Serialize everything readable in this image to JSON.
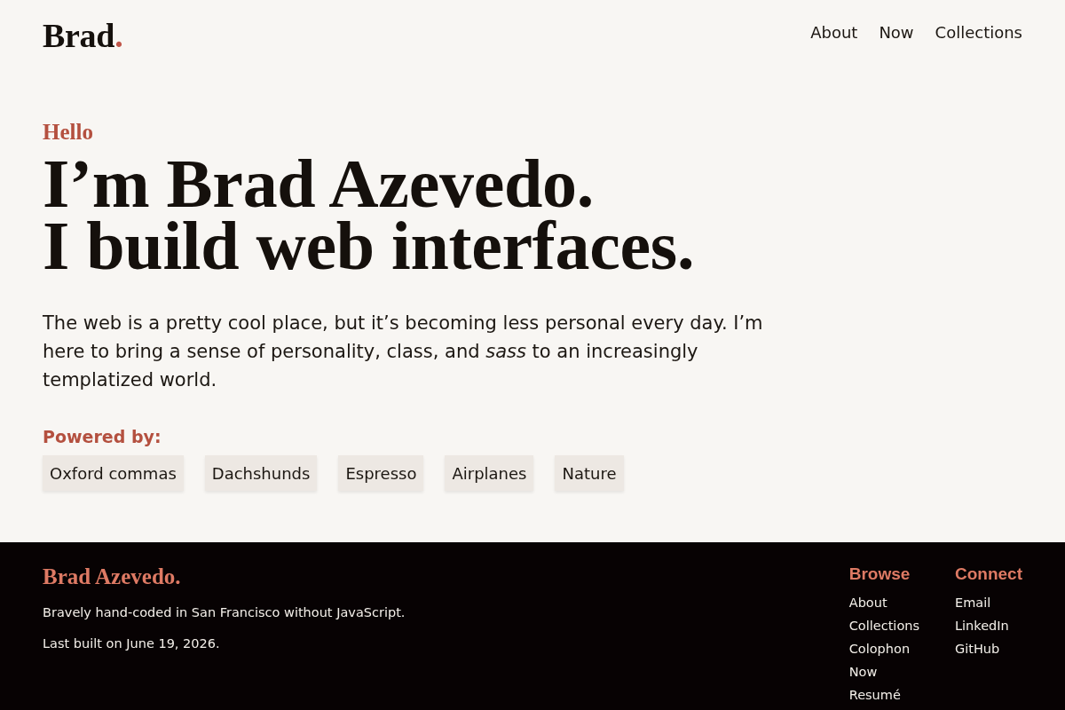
{
  "header": {
    "logo": {
      "text": "Brad",
      "mark": "."
    },
    "nav": [
      "About",
      "Now",
      "Collections"
    ]
  },
  "hero": {
    "eyebrow": "Hello",
    "heading_lines": [
      "I’m Brad Azevedo.",
      "I build web interfaces."
    ],
    "intro": "The web is a pretty cool place, but it’s becoming less personal every day. I’m here to bring a sense of personality, class, and *sass* to an increasingly templatized world."
  },
  "powered_by": {
    "label": "Powered by:",
    "tags": [
      "Oxford commas",
      "Dachshunds",
      "Espresso",
      "Airplanes",
      "Nature"
    ]
  },
  "footer": {
    "name": "Brad Azevedo.",
    "lines": [
      "Bravely hand-coded in San Francisco without JavaScript.",
      "Last built on June 19, 2026."
    ],
    "columns": [
      {
        "heading": "Browse",
        "links": [
          "About",
          "Collections",
          "Colophon",
          "Now",
          "Resumé"
        ]
      },
      {
        "heading": "Connect",
        "links": [
          "Email",
          "LinkedIn",
          "GitHub"
        ]
      }
    ]
  }
}
